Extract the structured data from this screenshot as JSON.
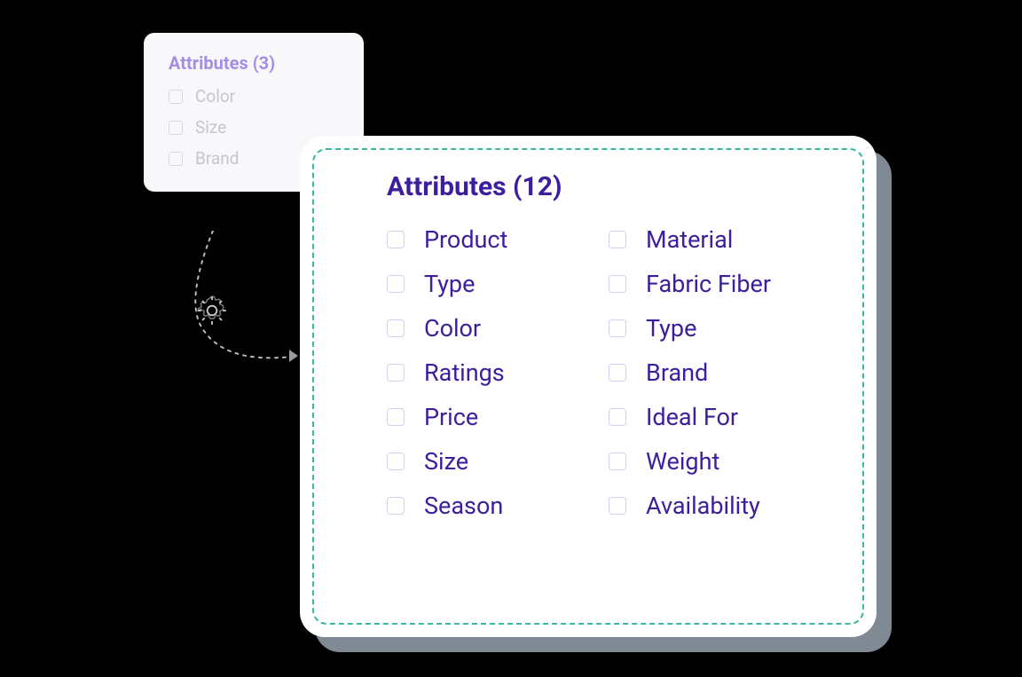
{
  "small_panel": {
    "title": "Attributes (3)",
    "items": [
      "Color",
      "Size",
      "Brand"
    ]
  },
  "large_panel": {
    "title": "Attributes (12)",
    "col1": [
      "Product",
      "Type",
      "Color",
      "Ratings",
      "Price",
      "Size",
      "Season"
    ],
    "col2": [
      "Material",
      "Fabric Fiber",
      "Type",
      "Brand",
      "Ideal For",
      "Weight",
      "Availability"
    ]
  },
  "colors": {
    "accent": "#3c1e9e",
    "dashed_border": "#39b8a0",
    "faded_accent": "#a48ee3"
  }
}
